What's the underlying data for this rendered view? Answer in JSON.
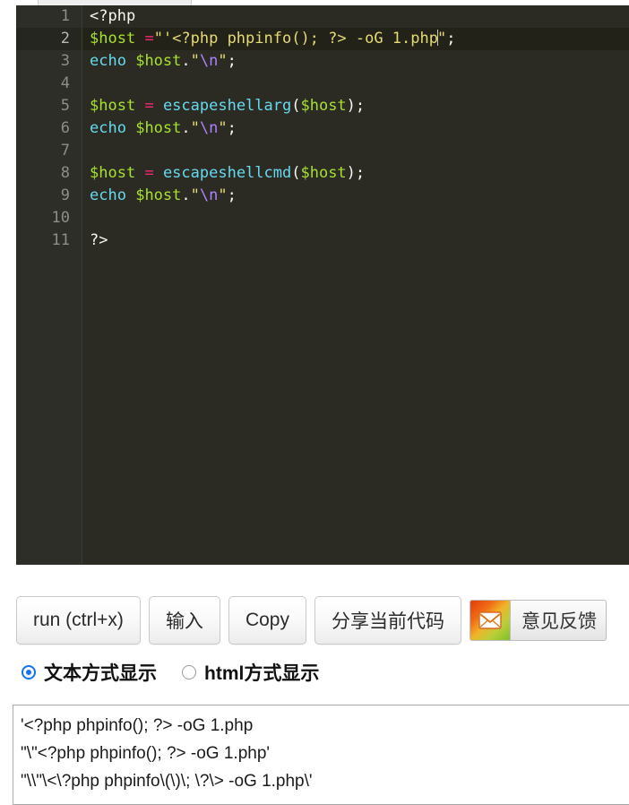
{
  "editor": {
    "tab": {
      "label": ""
    },
    "language": "php",
    "active_line": 2,
    "line_numbers": [
      "1",
      "2",
      "3",
      "4",
      "5",
      "6",
      "7",
      "8",
      "9",
      "10",
      "11"
    ],
    "lines": [
      {
        "n": "1",
        "text": "<?php"
      },
      {
        "n": "2",
        "text": "$host =\"'<?php phpinfo(); ?> -oG 1.php\";"
      },
      {
        "n": "3",
        "text": "echo $host.\"\\n\";"
      },
      {
        "n": "4",
        "text": ""
      },
      {
        "n": "5",
        "text": "$host = escapeshellarg($host);"
      },
      {
        "n": "6",
        "text": "echo $host.\"\\n\";"
      },
      {
        "n": "7",
        "text": ""
      },
      {
        "n": "8",
        "text": "$host = escapeshellcmd($host);"
      },
      {
        "n": "9",
        "text": "echo $host.\"\\n\";"
      },
      {
        "n": "10",
        "text": ""
      },
      {
        "n": "11",
        "text": "?>"
      }
    ],
    "tokens": {
      "l1_tag": "<?php",
      "l2_var": "$host",
      "l2_eq": "=",
      "l2_str": "\"'<?php phpinfo(); ?> -oG 1.php",
      "l2_strend": "\"",
      "l2_semi": ";",
      "l3_kw": "echo",
      "l3_var": "$host",
      "l3_dot": ".",
      "l3_q1": "\"",
      "l3_esc": "\\n",
      "l3_q2": "\"",
      "l3_semi": ";",
      "l5_var": "$host",
      "l5_eq": "=",
      "l5_fn": "escapeshellarg",
      "l5_open": "(",
      "l5_arg": "$host",
      "l5_close": ");",
      "l8_fn": "escapeshellcmd",
      "l11_tag": "?>"
    }
  },
  "toolbar": {
    "run_label": "run (ctrl+x)",
    "input_label": "输入",
    "copy_label": "Copy",
    "share_label": "分享当前代码",
    "feedback_label": "意见反馈",
    "feedback_icon": "envelope-icon"
  },
  "display_mode": {
    "selected": "text",
    "options": [
      {
        "value": "text",
        "label": "文本方式显示",
        "checked": true
      },
      {
        "value": "html",
        "label": "html方式显示",
        "checked": false
      }
    ]
  },
  "output": {
    "lines": [
      "'<?php phpinfo(); ?> -oG 1.php",
      "\"\\\"<?php phpinfo(); ?> -oG 1.php'",
      "\"\\\\\"\\<\\?php phpinfo\\(\\)\\; \\?\\> -oG 1.php\\'"
    ]
  },
  "colors": {
    "editor_bg": "#2b2b24",
    "gutter_bg": "#2d2e27",
    "active_line_bg": "#222219",
    "variable": "#a6e22e",
    "operator": "#f92672",
    "function": "#66d9ef",
    "string": "#e6db74",
    "escape": "#ae81ff",
    "radio_accent": "#1472f0"
  }
}
